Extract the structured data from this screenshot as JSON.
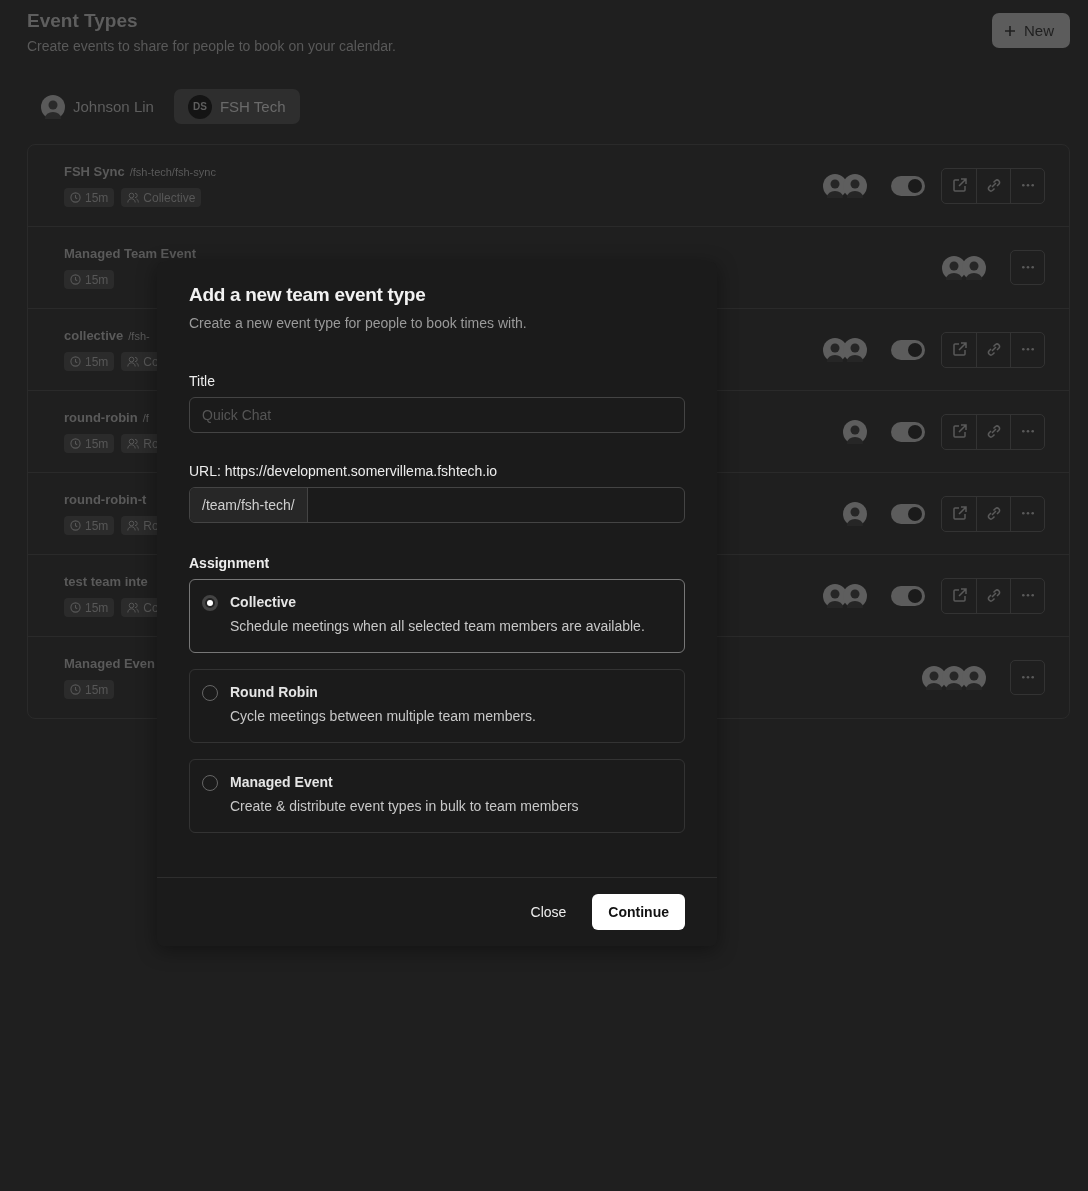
{
  "header": {
    "title": "Event Types",
    "subtitle": "Create events to share for people to book on your calendar.",
    "new_button": "New"
  },
  "profiles": [
    {
      "label": "Johnson Lin",
      "kind": "photo",
      "selected": false
    },
    {
      "label": "FSH Tech",
      "kind": "initials",
      "initials": "DS",
      "selected": true
    }
  ],
  "event_types": [
    {
      "kind": "team",
      "title": "FSH Sync",
      "slug": "/fsh-tech/fsh-sync",
      "duration": "15m",
      "scheduling": "Collective",
      "hosts": [
        {
          "kind": "person"
        },
        {
          "kind": "person"
        }
      ],
      "on": true
    },
    {
      "kind": "managed",
      "title": "Managed Team Event",
      "duration": "15m",
      "hosts": [
        {
          "kind": "person"
        },
        {
          "kind": "person"
        }
      ]
    },
    {
      "kind": "team",
      "title": "collective",
      "slug": "/fsh-",
      "duration": "15m",
      "scheduling": "Co",
      "hosts": [
        {
          "kind": "person"
        },
        {
          "kind": "person"
        }
      ],
      "on": true
    },
    {
      "kind": "team",
      "title": "round-robin",
      "slug": "/f",
      "duration": "15m",
      "scheduling": "Ro",
      "hosts": [
        {
          "kind": "person"
        }
      ],
      "on": true
    },
    {
      "kind": "team",
      "title": "round-robin-t",
      "duration": "15m",
      "scheduling": "Ro",
      "hosts": [
        {
          "kind": "person"
        }
      ],
      "on": true
    },
    {
      "kind": "team",
      "title": "test team inte",
      "duration": "15m",
      "scheduling": "Co",
      "hosts": [
        {
          "kind": "person"
        },
        {
          "kind": "person"
        }
      ],
      "on": true
    },
    {
      "kind": "managed",
      "title": "Managed Even",
      "duration": "15m",
      "hosts": [
        {
          "kind": "person"
        },
        {
          "kind": "person"
        },
        {
          "kind": "person"
        }
      ]
    }
  ],
  "dialog": {
    "title": "Add a new team event type",
    "subtitle": "Create a new event type for people to book times with.",
    "title_field": {
      "label": "Title",
      "placeholder": "Quick Chat"
    },
    "url_field": {
      "label": "URL: https://development.somervillema.fshtech.io",
      "prefix": "/team/fsh-tech/"
    },
    "assignment_label": "Assignment",
    "options": [
      {
        "title": "Collective",
        "description": "Schedule meetings when all selected team members are available.",
        "selected": true
      },
      {
        "title": "Round Robin",
        "description": "Cycle meetings between multiple team members.",
        "selected": false
      },
      {
        "title": "Managed Event",
        "description": "Create & distribute event types in bulk to team members",
        "selected": false
      }
    ],
    "buttons": [
      {
        "label": "Close",
        "kind": "secondary"
      },
      {
        "label": "Continue",
        "kind": "primary"
      }
    ]
  }
}
